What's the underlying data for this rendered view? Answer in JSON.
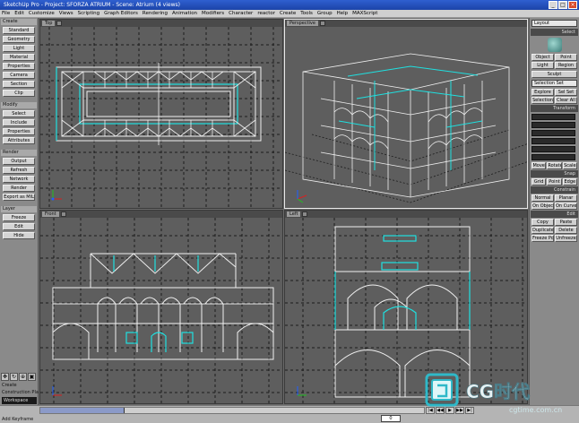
{
  "app": {
    "title": "SketchUp Pro - Project: SFORZA ATRIUM - Scene: Atrium (4 views)",
    "window_buttons": [
      "_",
      "□",
      "×"
    ]
  },
  "menu": [
    "File",
    "Edit",
    "Customize",
    "Views",
    "Scripting",
    "Graph Editors",
    "Rendering",
    "Animation",
    "Modifiers",
    "Character",
    "reactor",
    "Create",
    "Tools",
    "Group",
    "Help",
    "MAXScript"
  ],
  "left_panel": {
    "groups": [
      {
        "title": "Create",
        "buttons": [
          "Standard",
          "Geometry",
          "Light",
          "Material",
          "Properties",
          "Camera",
          "Section",
          "Clip"
        ]
      },
      {
        "title": "Modify",
        "buttons": [
          "Select",
          "Include",
          "Properties",
          "Attributes"
        ]
      },
      {
        "title": "Render",
        "buttons": [
          "Output",
          "Refresh",
          "Network",
          "Render",
          "Export as MIL"
        ]
      },
      {
        "title": "Layer",
        "buttons": [
          "Freeze",
          "Edit",
          "Hide"
        ]
      }
    ],
    "bottom_text": [
      "Create",
      "Construction Plane"
    ],
    "bottom_field": "Workspace"
  },
  "viewports": {
    "top": {
      "label": "Top"
    },
    "perspective": {
      "label": "Perspective"
    },
    "front": {
      "label": "Front"
    },
    "left": {
      "label": "Left"
    }
  },
  "right_panel": {
    "layout_label": "Layout",
    "sections": [
      {
        "title": "Select",
        "buttons": [
          "Object",
          "Point",
          "Light",
          "Region",
          "Sculpt"
        ]
      },
      {
        "title": "Selection",
        "input": "Selection Set",
        "buttons": [
          "Explore",
          "Sel Set",
          "Selection",
          "Clear All"
        ]
      },
      {
        "title": "Transform",
        "input": "",
        "buttons": [
          "Move",
          "Rotate",
          "Scale"
        ]
      },
      {
        "title": "Snap",
        "buttons": [
          "Grid",
          "Point",
          "Edge"
        ]
      },
      {
        "title": "Constrain",
        "buttons": [
          "Normal",
          "Planar",
          "On Object",
          "On Curve"
        ]
      },
      {
        "title": "Edit",
        "buttons": [
          "Copy",
          "Paste",
          "Duplicate",
          "Delete",
          "Freeze Pos",
          "Unfreeze"
        ]
      }
    ]
  },
  "status": {
    "text": "Add Keyframe",
    "frame": "0",
    "progress_fraction": 0.22,
    "play_buttons": [
      "|◀",
      "◀◀",
      "▶",
      "▶▶",
      "▶|"
    ]
  },
  "watermark": {
    "brand": "CG时代",
    "url": "cgtime.com.cn"
  },
  "colors": {
    "viewport_bg": "#5e5e5e",
    "wire_white": "#f0f0f0",
    "wire_cyan": "#1fe0e0",
    "grid": "#1c1c1c",
    "axis_x": "#d82020",
    "axis_y": "#20c020",
    "axis_z": "#2060ff"
  }
}
